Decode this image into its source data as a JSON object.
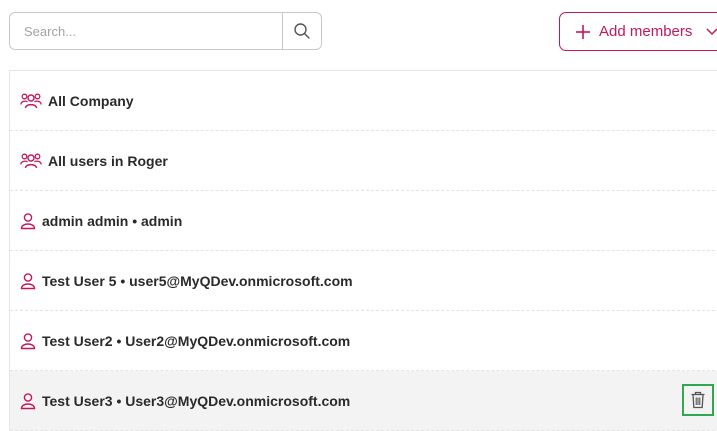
{
  "search": {
    "placeholder": "Search..."
  },
  "add_members": {
    "label": "Add members"
  },
  "members": [
    {
      "type": "group",
      "label": "All Company"
    },
    {
      "type": "group",
      "label": "All users in Roger"
    },
    {
      "type": "user",
      "label": "admin admin • admin"
    },
    {
      "type": "user",
      "label": "Test User 5 • user5@MyQDev.onmicrosoft.com"
    },
    {
      "type": "user",
      "label": "Test User2 • User2@MyQDev.onmicrosoft.com"
    },
    {
      "type": "user",
      "label": "Test User3 • User3@MyQDev.onmicrosoft.com",
      "highlighted": true
    }
  ],
  "colors": {
    "accent": "#c2185b",
    "highlight_border": "#2fa84f",
    "row_highlight": "#f3f3f3"
  }
}
